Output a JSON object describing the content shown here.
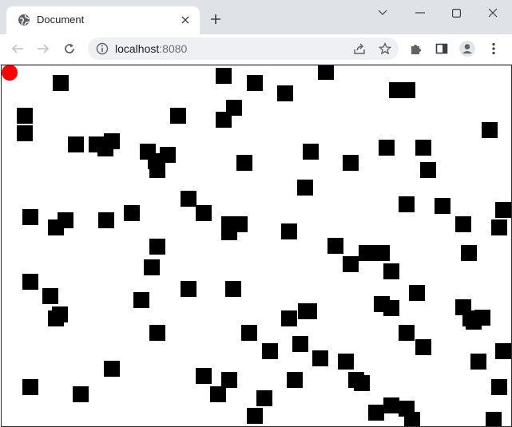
{
  "browser": {
    "tab_title": "Document",
    "url_host": "localhost",
    "url_port": ":8080",
    "icons": [
      "globe-icon",
      "close-icon",
      "plus-icon",
      "chevron-down-icon",
      "minimize-icon",
      "maximize-icon",
      "window-close-icon",
      "back-arrow-icon",
      "forward-arrow-icon",
      "reload-icon",
      "info-icon",
      "share-icon",
      "star-icon",
      "puzzle-icon",
      "sidepanel-icon",
      "profile-icon",
      "kebab-menu-icon"
    ]
  },
  "game": {
    "player_color": "#ff0000",
    "obstacle_color": "#000000",
    "background_color": "#ffffff"
  }
}
